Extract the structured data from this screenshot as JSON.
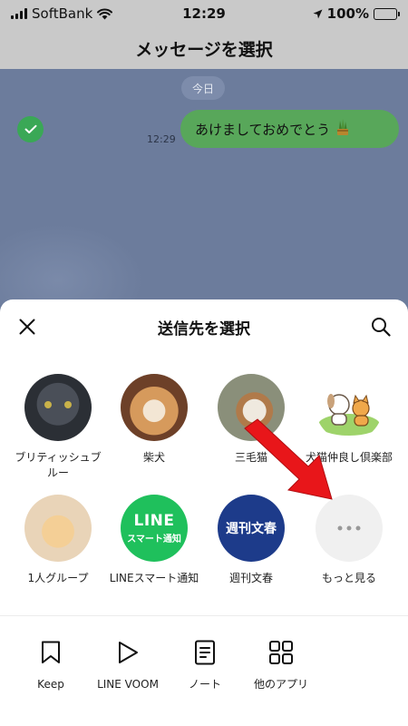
{
  "status_bar": {
    "carrier": "SoftBank",
    "time": "12:29",
    "battery": "100%"
  },
  "header": {
    "title": "メッセージを選択"
  },
  "chat": {
    "date_label": "今日",
    "message": {
      "time": "12:29",
      "text": "あけましておめでとう"
    }
  },
  "sheet": {
    "title": "送信先を選択",
    "contacts": [
      {
        "name": "ブリティッシュブルー"
      },
      {
        "name": "柴犬"
      },
      {
        "name": "三毛猫"
      },
      {
        "name": "犬猫仲良し倶楽部"
      },
      {
        "name": "1人グループ"
      },
      {
        "name": "LINEスマート通知",
        "avatar_big": "LINE",
        "avatar_small": "スマート通知"
      },
      {
        "name": "週刊文春",
        "avatar_text": "週刊文春"
      },
      {
        "name": "もっと見る"
      }
    ],
    "apps": [
      {
        "label": "Keep",
        "icon": "bookmark-icon"
      },
      {
        "label": "LINE VOOM",
        "icon": "voom-play-icon"
      },
      {
        "label": "ノート",
        "icon": "note-icon"
      },
      {
        "label": "他のアプリ",
        "icon": "apps-grid-icon"
      }
    ]
  },
  "colors": {
    "chat_background": "#6c7c9c",
    "bubble": "#58a75a",
    "line_green": "#1fc05c",
    "arrow": "#e8161a"
  }
}
